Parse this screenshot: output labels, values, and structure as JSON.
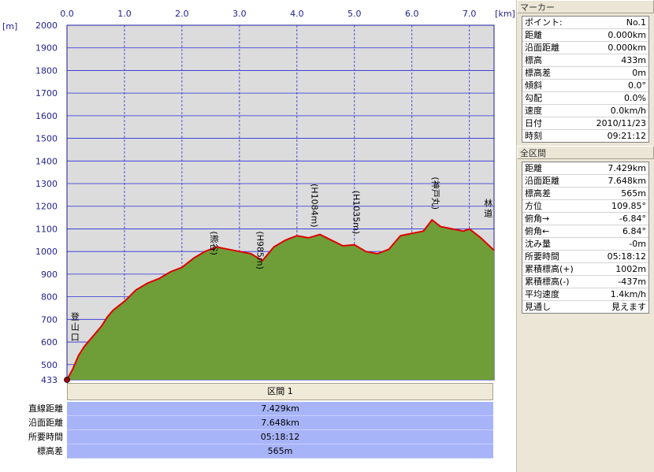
{
  "chart_data": {
    "type": "area",
    "x_unit_label": "[km]",
    "y_unit_label": "[m]",
    "xlim": [
      0,
      7.429
    ],
    "ylim": [
      433,
      2000
    ],
    "x_ticks": [
      "0.0",
      "1.0",
      "2.0",
      "3.0",
      "4.0",
      "5.0",
      "6.0",
      "7.0"
    ],
    "y_ticks": [
      "2000",
      "1900",
      "1800",
      "1700",
      "1600",
      "1500",
      "1400",
      "1300",
      "1200",
      "1100",
      "1000",
      "900",
      "800",
      "700",
      "600",
      "500",
      "433"
    ],
    "x": [
      0.0,
      0.1,
      0.2,
      0.3,
      0.4,
      0.5,
      0.6,
      0.7,
      0.8,
      0.9,
      1.0,
      1.2,
      1.4,
      1.6,
      1.8,
      2.0,
      2.2,
      2.4,
      2.6,
      2.8,
      3.0,
      3.2,
      3.4,
      3.6,
      3.8,
      4.0,
      4.2,
      4.4,
      4.6,
      4.8,
      5.0,
      5.2,
      5.4,
      5.6,
      5.8,
      6.0,
      6.2,
      6.35,
      6.5,
      6.7,
      6.9,
      7.0,
      7.2,
      7.429
    ],
    "y": [
      433,
      480,
      540,
      580,
      610,
      640,
      670,
      710,
      740,
      760,
      780,
      830,
      860,
      880,
      910,
      930,
      970,
      1000,
      1020,
      1010,
      1000,
      990,
      960,
      1020,
      1050,
      1070,
      1060,
      1075,
      1050,
      1025,
      1030,
      1000,
      990,
      1010,
      1070,
      1080,
      1090,
      1140,
      1110,
      1100,
      1090,
      1100,
      1060,
      1005
    ],
    "line_color": "#e00000",
    "fill_color": "#6f9e38",
    "plot_bg": "#dcdcdc",
    "grid_color": "#2b2bd8",
    "annotations": [
      {
        "text": "登山口",
        "x": 0.14,
        "y": 700,
        "vertical": true
      },
      {
        "text": "(熊谷)",
        "x": 2.55,
        "y": 1090,
        "vertical": true
      },
      {
        "text": "(H985m)",
        "x": 3.35,
        "y": 1090,
        "vertical": true
      },
      {
        "text": "(H1084m)",
        "x": 4.3,
        "y": 1300,
        "vertical": true
      },
      {
        "text": "(H1035m)",
        "x": 5.02,
        "y": 1270,
        "vertical": true
      },
      {
        "text": "(神戸丸)",
        "x": 6.4,
        "y": 1330,
        "vertical": true
      },
      {
        "text": "林道",
        "x": 7.33,
        "y": 1200,
        "vertical": true
      }
    ]
  },
  "section": {
    "header": "区間 1",
    "rows": [
      {
        "label": "直線距離",
        "value": "7.429km"
      },
      {
        "label": "沿面距離",
        "value": "7.648km"
      },
      {
        "label": "所要時間",
        "value": "05:18:12"
      },
      {
        "label": "標高差",
        "value": "565m"
      }
    ]
  },
  "marker": {
    "title": "マーカー",
    "rows": [
      {
        "k": "ポイント:",
        "v": "No.1"
      },
      {
        "k": "距離",
        "v": "0.000km"
      },
      {
        "k": "沿面距離",
        "v": "0.000km"
      },
      {
        "k": "標高",
        "v": "433m"
      },
      {
        "k": "標高差",
        "v": "0m"
      },
      {
        "k": "傾斜",
        "v": "0.0°"
      },
      {
        "k": "勾配",
        "v": "0.0%"
      },
      {
        "k": "速度",
        "v": "0.0km/h"
      },
      {
        "k": "日付",
        "v": "2010/11/23"
      },
      {
        "k": "時刻",
        "v": "09:21:12"
      }
    ]
  },
  "all_sections": {
    "title": "全区間",
    "rows": [
      {
        "k": "距離",
        "v": "7.429km"
      },
      {
        "k": "沿面距離",
        "v": "7.648km"
      },
      {
        "k": "標高差",
        "v": "565m"
      },
      {
        "k": "方位",
        "v": "109.85°"
      },
      {
        "k": "俯角→",
        "v": "-6.84°"
      },
      {
        "k": "俯角←",
        "v": "6.84°"
      },
      {
        "k": "沈み量",
        "v": "-0m"
      },
      {
        "k": "所要時間",
        "v": "05:18:12"
      },
      {
        "k": "累積標高(+)",
        "v": "1002m"
      },
      {
        "k": "累積標高(-)",
        "v": "-437m"
      },
      {
        "k": "平均速度",
        "v": "1.4km/h"
      },
      {
        "k": "見通し",
        "v": "見えます"
      }
    ]
  }
}
